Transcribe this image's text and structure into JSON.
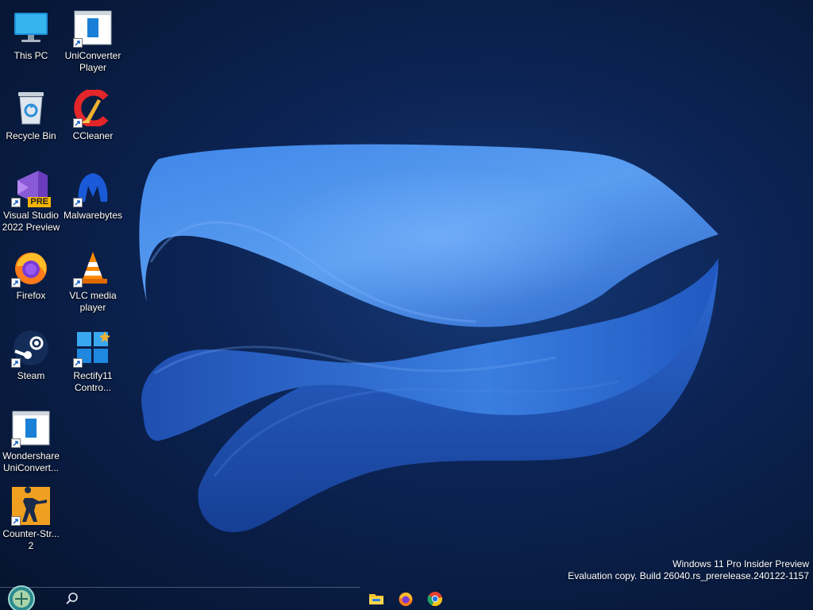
{
  "desktop": {
    "icons": [
      {
        "label": "This PC",
        "icon": "this-pc-icon",
        "shortcut": false
      },
      {
        "label": "UniConverter Player",
        "icon": "uniconverter-player-icon",
        "shortcut": true
      },
      {
        "label": "Recycle Bin",
        "icon": "recycle-bin-icon",
        "shortcut": false
      },
      {
        "label": "CCleaner",
        "icon": "ccleaner-icon",
        "shortcut": true
      },
      {
        "label": "Visual Studio 2022 Preview",
        "icon": "visual-studio-icon",
        "shortcut": true,
        "badge": "PRE"
      },
      {
        "label": "Malwarebytes",
        "icon": "malwarebytes-icon",
        "shortcut": true
      },
      {
        "label": "Firefox",
        "icon": "firefox-icon",
        "shortcut": true
      },
      {
        "label": "VLC media player",
        "icon": "vlc-icon",
        "shortcut": true
      },
      {
        "label": "Steam",
        "icon": "steam-icon",
        "shortcut": true
      },
      {
        "label": "Rectify11 Contro...",
        "icon": "rectify11-icon",
        "shortcut": true
      },
      {
        "label": "Wondershare UniConvert...",
        "icon": "wondershare-uniconverter-icon",
        "shortcut": true
      },
      {
        "label": "Counter-Str... 2",
        "icon": "counter-strike-icon",
        "shortcut": true
      }
    ]
  },
  "watermark": {
    "line1": "Windows 11 Pro Insider Preview",
    "line2": "Evaluation copy. Build 26040.rs_prerelease.240122-1157"
  },
  "taskbar": {
    "items": [
      {
        "name": "start-button",
        "icon": "start-orb-icon"
      },
      {
        "name": "search-button",
        "icon": "search-icon"
      },
      {
        "name": "file-explorer-button",
        "icon": "file-explorer-icon"
      },
      {
        "name": "firefox-taskbar-button",
        "icon": "firefox-icon"
      },
      {
        "name": "chrome-taskbar-button",
        "icon": "chrome-icon"
      }
    ]
  },
  "colors": {
    "accent": "#2f6fd6",
    "wallpaper_dark": "#081a3d"
  }
}
